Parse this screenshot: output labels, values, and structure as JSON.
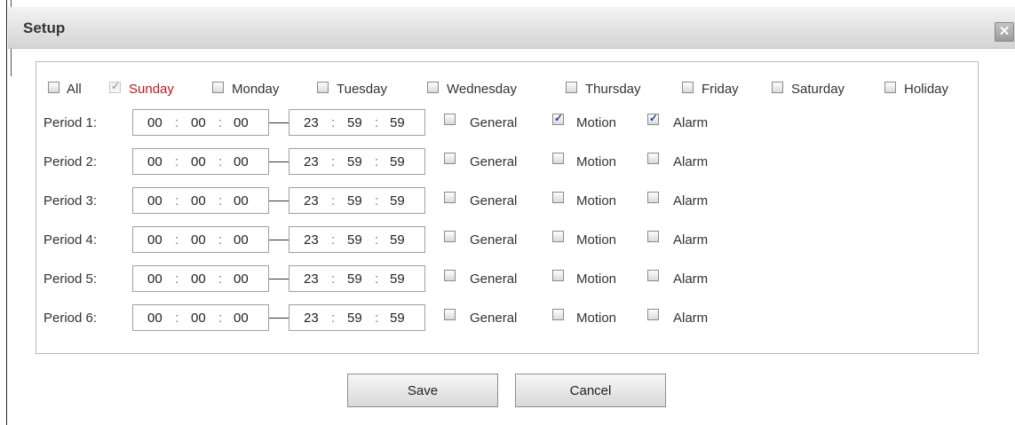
{
  "dialog": {
    "title": "Setup",
    "close_symbol": "✕"
  },
  "days": [
    {
      "label": "All",
      "checked": false,
      "disabled": false,
      "highlight": false
    },
    {
      "label": "Sunday",
      "checked": true,
      "disabled": true,
      "highlight": true
    },
    {
      "label": "Monday",
      "checked": false,
      "disabled": false,
      "highlight": false
    },
    {
      "label": "Tuesday",
      "checked": false,
      "disabled": false,
      "highlight": false
    },
    {
      "label": "Wednesday",
      "checked": false,
      "disabled": false,
      "highlight": false
    },
    {
      "label": "Thursday",
      "checked": false,
      "disabled": false,
      "highlight": false
    },
    {
      "label": "Friday",
      "checked": false,
      "disabled": false,
      "highlight": false
    },
    {
      "label": "Saturday",
      "checked": false,
      "disabled": false,
      "highlight": false
    },
    {
      "label": "Holiday",
      "checked": false,
      "disabled": false,
      "highlight": false
    }
  ],
  "time_separator": ":",
  "record_types": [
    "General",
    "Motion",
    "Alarm"
  ],
  "periods": [
    {
      "label": "Period 1:",
      "start": [
        "00",
        "00",
        "00"
      ],
      "end": [
        "23",
        "59",
        "59"
      ],
      "general": false,
      "motion": true,
      "alarm": true
    },
    {
      "label": "Period 2:",
      "start": [
        "00",
        "00",
        "00"
      ],
      "end": [
        "23",
        "59",
        "59"
      ],
      "general": false,
      "motion": false,
      "alarm": false
    },
    {
      "label": "Period 3:",
      "start": [
        "00",
        "00",
        "00"
      ],
      "end": [
        "23",
        "59",
        "59"
      ],
      "general": false,
      "motion": false,
      "alarm": false
    },
    {
      "label": "Period 4:",
      "start": [
        "00",
        "00",
        "00"
      ],
      "end": [
        "23",
        "59",
        "59"
      ],
      "general": false,
      "motion": false,
      "alarm": false
    },
    {
      "label": "Period 5:",
      "start": [
        "00",
        "00",
        "00"
      ],
      "end": [
        "23",
        "59",
        "59"
      ],
      "general": false,
      "motion": false,
      "alarm": false
    },
    {
      "label": "Period 6:",
      "start": [
        "00",
        "00",
        "00"
      ],
      "end": [
        "23",
        "59",
        "59"
      ],
      "general": false,
      "motion": false,
      "alarm": false
    }
  ],
  "buttons": {
    "save_label": "Save",
    "cancel_label": "Cancel"
  },
  "colors": {
    "highlight_day": "#c0181a",
    "check": "#1f3f9a"
  }
}
